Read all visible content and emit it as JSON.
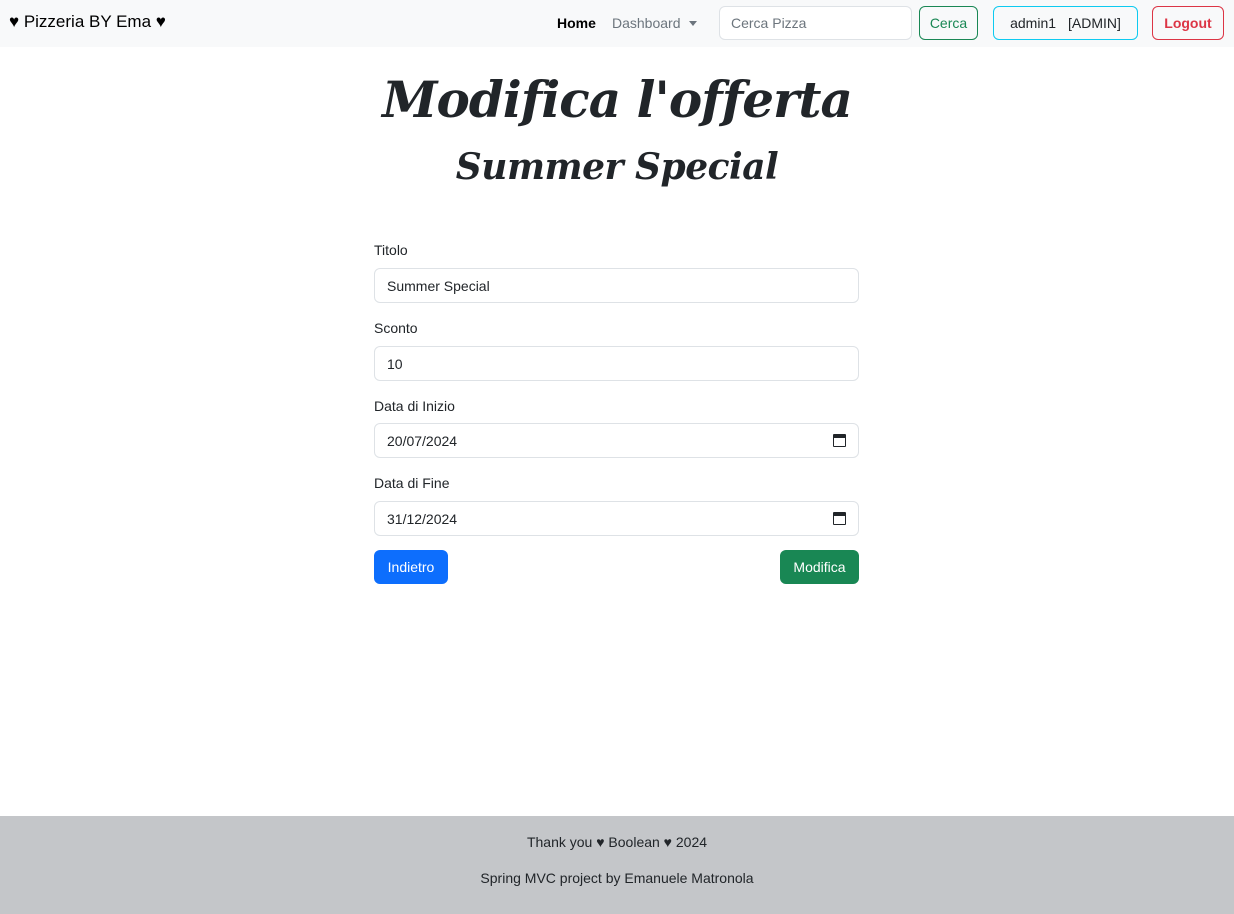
{
  "navbar": {
    "brand": "♥ Pizzeria BY Ema ♥",
    "home_label": "Home",
    "dashboard_label": "Dashboard",
    "search_placeholder": "Cerca Pizza",
    "search_button": "Cerca",
    "user_name": "admin1",
    "user_role": "[ADMIN]",
    "logout_label": "Logout"
  },
  "page": {
    "title": "Modifica l'offerta",
    "subtitle": "Summer Special"
  },
  "form": {
    "title_label": "Titolo",
    "title_value": "Summer Special",
    "discount_label": "Sconto",
    "discount_value": "10",
    "start_label": "Data di Inizio",
    "start_value": "20/07/2024",
    "end_label": "Data di Fine",
    "end_value": "31/12/2024",
    "back_button": "Indietro",
    "submit_button": "Modifica"
  },
  "footer": {
    "line1": "Thank you ♥ Boolean ♥ 2024",
    "line2": "Spring MVC project by Emanuele Matronola"
  },
  "colors": {
    "primary": "#0d6efd",
    "success": "#198754",
    "danger": "#dc3545",
    "info": "#0dcaf0",
    "footer_bg": "#c4c6c9",
    "navbar_bg": "#f8f9fa"
  }
}
